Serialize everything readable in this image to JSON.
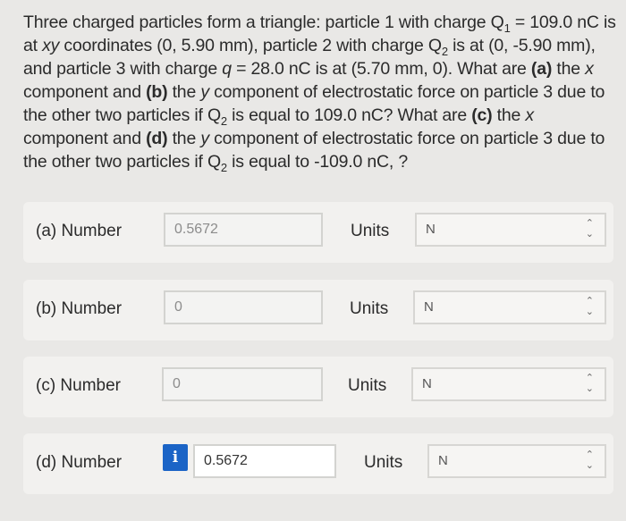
{
  "problem": {
    "t1": "Three charged particles form a triangle: particle 1 with charge Q",
    "sub1": "1",
    "t2": " = 109.0 nC is at ",
    "xy1": "xy",
    "t3": " coordinates (0, 5.90 mm), particle 2 with charge Q",
    "sub2": "2",
    "t4": " is at (0, -5.90 mm), and particle 3 with charge ",
    "q": "q",
    "t5": " = 28.0 nC is at (5.70 mm, 0). What are ",
    "a": "(a)",
    "t6": " the ",
    "x1": "x",
    "t7": " component and ",
    "b": "(b)",
    "t8": " the ",
    "y1": "y",
    "t9": " component of electrostatic force on particle 3 due to the other two particles if Q",
    "sub3": "2",
    "t10": " is equal to 109.0 nC? What are ",
    "c": "(c)",
    "t11": " the ",
    "x2": "x",
    "t12": " component and ",
    "d": "(d)",
    "t13": " the ",
    "y2": "y",
    "t14": " component of electrostatic force on particle 3 due to the other two particles if Q",
    "sub4": "2",
    "t15": " is equal to -109.0 nC, ?"
  },
  "parts": [
    {
      "label": "(a)   Number",
      "value": "0.5672",
      "units_label": "Units",
      "unit": "N"
    },
    {
      "label": "(b)   Number",
      "value": "0",
      "units_label": "Units",
      "unit": "N"
    },
    {
      "label": "(c)   Number",
      "value": "0",
      "units_label": "Units",
      "unit": "N"
    },
    {
      "label": "(d)   Number",
      "value": "0.5672",
      "units_label": "Units",
      "unit": "N",
      "info": "i"
    }
  ],
  "icons": {
    "chevron": "up-down-chevron-icon",
    "info": "info-icon",
    "info_color": "#1b64c6"
  }
}
